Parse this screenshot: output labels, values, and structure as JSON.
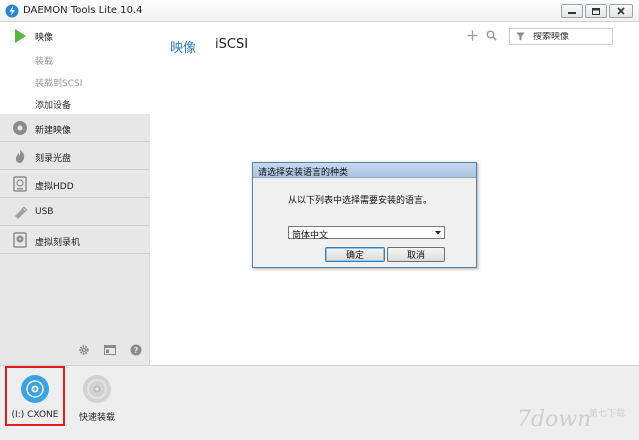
{
  "window": {
    "title": "DAEMON Tools Lite 10.4"
  },
  "sidebar": {
    "active_section": {
      "label": "映像",
      "sub_items": [
        "装载",
        "装载到SCSI",
        "添加设备"
      ]
    },
    "items": [
      {
        "label": "新建映像",
        "icon": "disc-icon"
      },
      {
        "label": "刻录光盘",
        "icon": "flame-icon"
      },
      {
        "label": "虚拟HDD",
        "icon": "hdd-icon"
      },
      {
        "label": "USB",
        "icon": "usb-icon"
      },
      {
        "label": "虚拟刻录机",
        "icon": "burner-icon"
      }
    ],
    "tools": [
      "gear-icon",
      "panel-icon",
      "help-icon"
    ]
  },
  "main": {
    "tabs": [
      {
        "label": "映像",
        "active": true
      },
      {
        "label": "iSCSI",
        "active": false
      }
    ],
    "search": {
      "placeholder": "搜索映像"
    }
  },
  "dialog": {
    "title": "请选择安装语言的种类",
    "prompt": "从以下列表中选择需要安装的语言。",
    "selected_language": "简体中文",
    "ok_label": "确定",
    "cancel_label": "取消"
  },
  "bottombar": {
    "drives": [
      {
        "label": "(I:) CXONE",
        "selected": true
      },
      {
        "label": "快速装载",
        "selected": false
      }
    ]
  },
  "colors": {
    "accent": "#2d7bc4",
    "highlight": "#e01e1e",
    "drive_blue": "#3aa3e3"
  }
}
